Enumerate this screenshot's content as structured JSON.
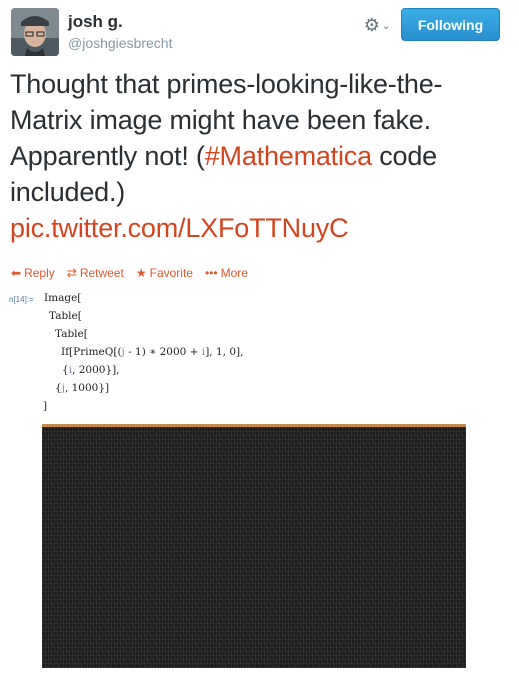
{
  "user": {
    "name": "josh g.",
    "handle": "@joshgiesbrecht"
  },
  "follow_button": {
    "label": "Following"
  },
  "tweet": {
    "line1": "Thought that primes-looking-like-the-",
    "line2": "Matrix image might have been fake.",
    "line3_before": "Apparently not! (",
    "hashtag": "#Mathematica",
    "line3_after": " code",
    "line4": "included.)",
    "link": "pic.twitter.com/LXFoTTNuyC"
  },
  "actions": [
    {
      "label": "Reply",
      "icon": "reply-icon"
    },
    {
      "label": "Retweet",
      "icon": "retweet-icon"
    },
    {
      "label": "Favorite",
      "icon": "star-icon"
    },
    {
      "label": "More",
      "icon": "more-icon"
    }
  ],
  "code": {
    "input_label": "n[14]:=",
    "line1": "Image[",
    "line2": "Table[",
    "line3": "Table[",
    "line4a": "If[PrimeQ[(",
    "line4_j": "j",
    "line4b": " - 1) ∗ 2000 + ",
    "line4_i": "i",
    "line4c": "], 1, 0],",
    "line5a": "{",
    "line5_i": "i",
    "line5b": ", 2000}],",
    "line6a": "{",
    "line6_j": "j",
    "line6b": ", 1000}]",
    "line7": "]"
  },
  "colors": {
    "accent": "#d4451e",
    "follow_button": "#2a9ad9",
    "handle": "#8899a6"
  }
}
